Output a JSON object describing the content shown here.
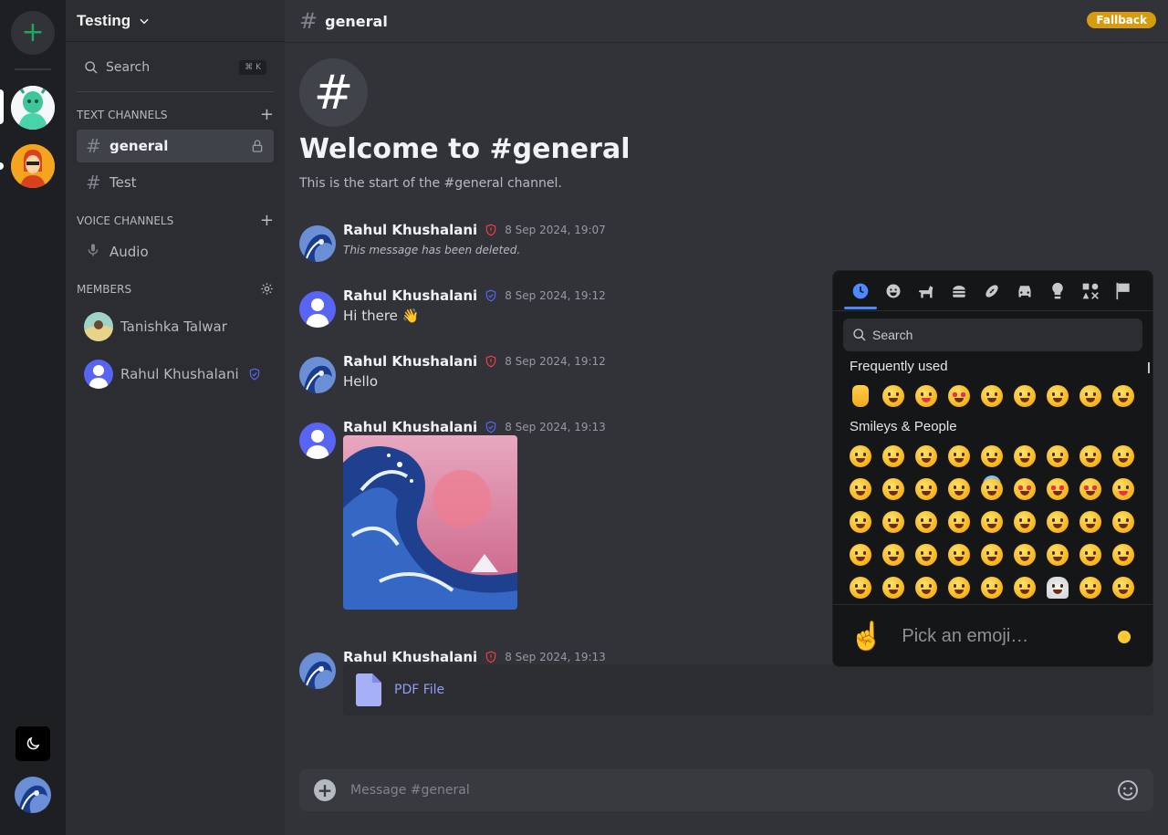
{
  "server": {
    "name": "Testing"
  },
  "search": {
    "label": "Search",
    "shortcut": "⌘ K"
  },
  "text_channels": {
    "title": "TEXT CHANNELS",
    "items": [
      {
        "name": "general",
        "active": true,
        "locked": true
      },
      {
        "name": "Test",
        "active": false
      }
    ]
  },
  "voice_channels": {
    "title": "VOICE CHANNELS",
    "items": [
      {
        "name": "Audio"
      }
    ]
  },
  "members": {
    "title": "MEMBERS",
    "items": [
      {
        "name": "Tanishka Talwar",
        "role_badge": false
      },
      {
        "name": "Rahul Khushalani",
        "role_badge": true
      }
    ]
  },
  "channel": {
    "name": "general",
    "badge": "Fallback",
    "welcome_icon": "#",
    "welcome_title": "Welcome to #general",
    "welcome_subtitle": "This is the start of the #general channel."
  },
  "messages": [
    {
      "author": "Rahul Khushalani",
      "role": "admin",
      "time": "8 Sep 2024, 19:07",
      "text": "This message has been deleted.",
      "deleted": true
    },
    {
      "author": "Rahul Khushalani",
      "role": "moderator",
      "time": "8 Sep 2024, 19:12",
      "text": "Hi there 👋"
    },
    {
      "author": "Rahul Khushalani",
      "role": "admin",
      "time": "8 Sep 2024, 19:12",
      "text": "Hello"
    },
    {
      "author": "Rahul Khushalani",
      "role": "moderator",
      "time": "8 Sep 2024, 19:13",
      "attachment": "image"
    },
    {
      "author": "Rahul Khushalani",
      "role": "admin",
      "time": "8 Sep 2024, 19:13",
      "file_name": "PDF File"
    }
  ],
  "composer": {
    "placeholder": "Message #general"
  },
  "emoji_picker": {
    "tabs": [
      "recent-icon",
      "smiley-icon",
      "animal-icon",
      "food-icon",
      "activity-icon",
      "travel-icon",
      "objects-icon",
      "symbols-icon",
      "flags-icon"
    ],
    "active_tab": "recent-icon",
    "search_placeholder": "Search",
    "frequently_used_title": "Frequently used",
    "smileys_title": "Smileys & People",
    "footer_preview": "☝️",
    "footer_text": "Pick an emoji…"
  },
  "colors": {
    "accent": "#5865f2",
    "fallback_badge": "#d79b0e",
    "admin_shield": "#f23f42",
    "mod_shield": "#5865f2",
    "link": "#949cf7"
  }
}
